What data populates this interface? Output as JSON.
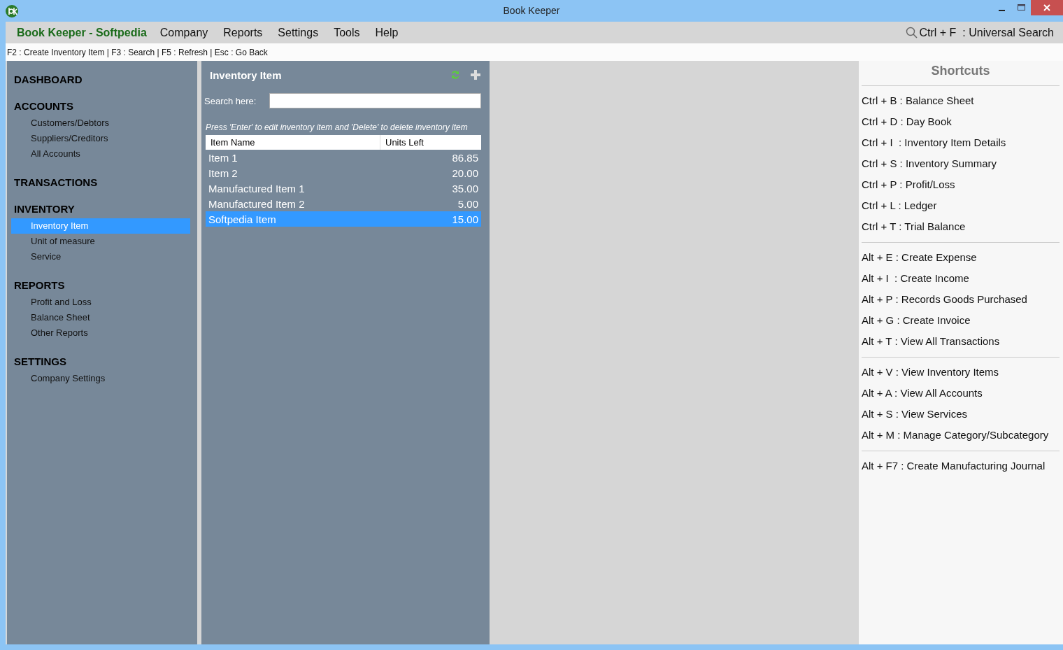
{
  "window": {
    "title": "Book Keeper"
  },
  "menu": {
    "brand": "Book Keeper - Softpedia",
    "items": [
      "Company",
      "Reports",
      "Settings",
      "Tools",
      "Help"
    ],
    "search": "Ctrl + F  : Universal Search"
  },
  "hint_bar": "F2 : Create Inventory Item | F3 : Search | F5 : Refresh | Esc : Go Back",
  "sidebar": {
    "sections": [
      {
        "title": "DASHBOARD"
      },
      {
        "title": "ACCOUNTS",
        "items": [
          {
            "label": "Customers/Debtors",
            "selected": false
          },
          {
            "label": "Suppliers/Creditors",
            "selected": false
          },
          {
            "label": "All Accounts",
            "selected": false
          }
        ]
      },
      {
        "title": "TRANSACTIONS"
      },
      {
        "title": "INVENTORY",
        "items": [
          {
            "label": "Inventory Item",
            "selected": true
          },
          {
            "label": "Unit of measure",
            "selected": false
          },
          {
            "label": "Service",
            "selected": false
          }
        ]
      },
      {
        "title": "REPORTS",
        "items": [
          {
            "label": "Profit and Loss",
            "selected": false
          },
          {
            "label": "Balance Sheet",
            "selected": false
          },
          {
            "label": "Other Reports",
            "selected": false
          }
        ]
      },
      {
        "title": "SETTINGS",
        "items": [
          {
            "label": "Company Settings",
            "selected": false
          }
        ]
      }
    ]
  },
  "inventory": {
    "title": "Inventory Item",
    "search_label": "Search here:",
    "instructions": "Press 'Enter' to edit inventory item and 'Delete' to delete inventory item",
    "table": {
      "columns": [
        "Item Name",
        "Units Left"
      ],
      "rows": [
        {
          "name": "Item 1",
          "units": "86.85",
          "selected": false
        },
        {
          "name": "Item 2",
          "units": "20.00",
          "selected": false
        },
        {
          "name": "Manufactured Item 1",
          "units": "35.00",
          "selected": false
        },
        {
          "name": "Manufactured Item 2",
          "units": "5.00",
          "selected": false
        },
        {
          "name": "Softpedia Item",
          "units": "15.00",
          "selected": true
        }
      ]
    }
  },
  "shortcuts": {
    "title": "Shortcuts",
    "groups": [
      [
        "Ctrl + B : Balance Sheet",
        "Ctrl + D : Day Book",
        "Ctrl + I  : Inventory Item Details",
        "Ctrl + S : Inventory Summary",
        "Ctrl + P : Profit/Loss",
        "Ctrl + L : Ledger",
        "Ctrl + T : Trial Balance"
      ],
      [
        "Alt + E : Create Expense",
        "Alt + I  : Create Income",
        "Alt + P : Records Goods Purchased",
        "Alt + G : Create Invoice",
        "Alt + T : View All Transactions"
      ],
      [
        "Alt + V : View Inventory Items",
        "Alt + A : View All Accounts",
        "Alt + S : View Services",
        "Alt + M : Manage Category/Subcategory"
      ],
      [
        "Alt + F7 : Create Manufacturing Journal"
      ]
    ]
  }
}
